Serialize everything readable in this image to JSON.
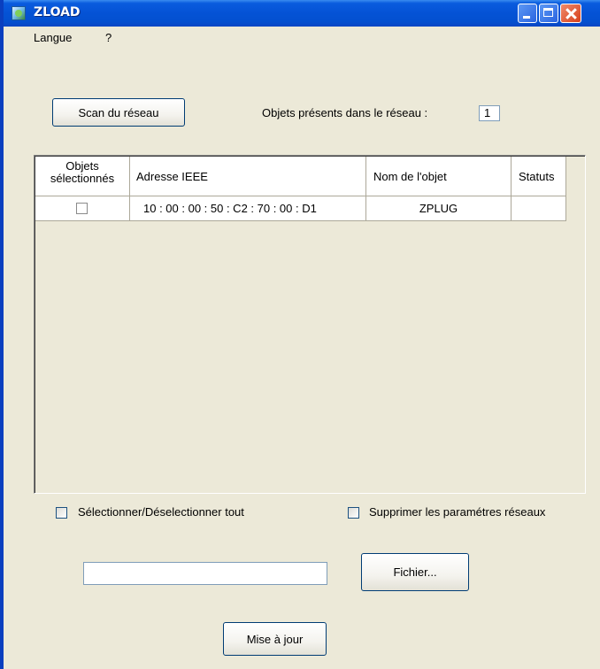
{
  "window": {
    "title": "ZLOAD",
    "titlebar_color": "#0553d6",
    "close_color": "#d6401c"
  },
  "menu": {
    "items": [
      {
        "label": "Langue"
      },
      {
        "label": "?"
      }
    ]
  },
  "scan": {
    "button_label": "Scan du réseau",
    "count_label": "Objets présents dans le réseau :",
    "count_value": "1"
  },
  "table": {
    "columns": [
      {
        "label": "Objets\nsélectionnés"
      },
      {
        "label": "Adresse IEEE"
      },
      {
        "label": "Nom de l'objet"
      },
      {
        "label": "Statuts"
      }
    ],
    "rows": [
      {
        "selected": false,
        "ieee": "10 : 00 : 00 : 50 : C2 : 70 : 00 : D1",
        "name": "ZPLUG",
        "status": ""
      }
    ]
  },
  "options": {
    "select_all_label": "Sélectionner/Déselectionner tout",
    "delete_network_label": "Supprimer les paramétres réseaux"
  },
  "file": {
    "path_value": "",
    "browse_label": "Fichier..."
  },
  "update": {
    "button_label": "Mise à jour"
  }
}
